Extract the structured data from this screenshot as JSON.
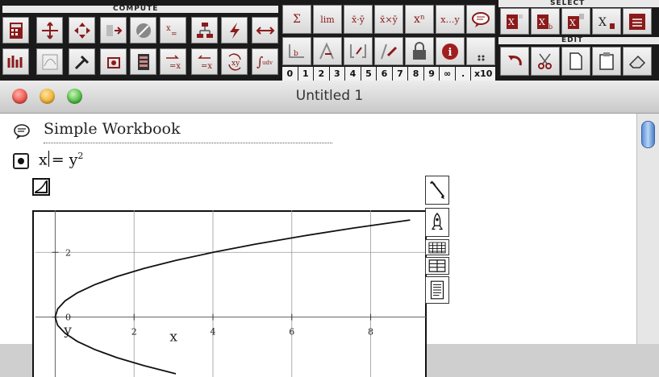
{
  "palette": {
    "compute_label": "COMPUTE",
    "select_label": "SELECT",
    "edit_label": "EDIT",
    "math_keys": [
      "Σ",
      "lim",
      "x̄·ȳ",
      "x̄×ȳ",
      "xⁿ",
      "x…y"
    ],
    "number_keys": [
      "0",
      "1",
      "2",
      "3",
      "4",
      "5",
      "6",
      "7",
      "8",
      "9",
      "∞",
      ".",
      "x10"
    ]
  },
  "window": {
    "title": "Untitled 1"
  },
  "document": {
    "workbook_title": "Simple Workbook",
    "formula": {
      "lhs": "x",
      "rhs": "= y",
      "exponent": "2"
    }
  },
  "chart_data": {
    "type": "line",
    "series": [
      {
        "x": [
          0,
          0.06,
          0.25,
          0.56,
          1,
          1.56,
          2.25,
          3.06,
          4,
          5.06,
          6.25,
          7.56,
          9
        ],
        "y": [
          0,
          0.25,
          0.5,
          0.75,
          1,
          1.25,
          1.5,
          1.75,
          2,
          2.25,
          2.5,
          2.75,
          3
        ]
      },
      {
        "x": [
          0,
          0.06,
          0.25,
          0.56,
          1,
          1.56,
          2.25,
          3.06
        ],
        "y": [
          0,
          -0.25,
          -0.5,
          -0.75,
          -1,
          -1.25,
          -1.5,
          -1.75
        ]
      }
    ],
    "xlabel": "x",
    "ylabel": "y",
    "x_ticks": [
      2,
      4,
      6,
      8
    ],
    "y_ticks": [
      0,
      2
    ],
    "xlim": [
      -0.5,
      9.4
    ],
    "ylim": [
      -1.85,
      3.3
    ],
    "grid": true
  },
  "colors": {
    "icon_accent": "#8b1a1a",
    "scroll_thumb": "#5a8ed8",
    "close_light": "#ee5b52",
    "minimize_light": "#f2b53b",
    "zoom_light": "#57c04a"
  }
}
